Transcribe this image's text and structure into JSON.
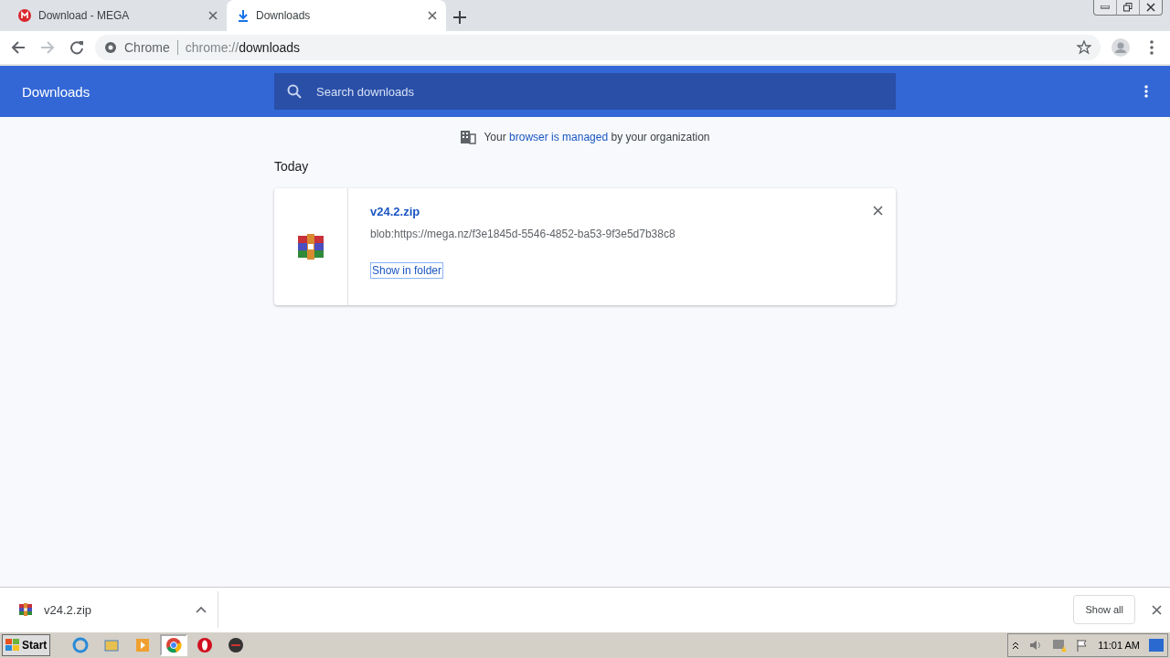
{
  "tabs": [
    {
      "title": "Download - MEGA",
      "kind": "mega",
      "selected": false
    },
    {
      "title": "Downloads",
      "kind": "download",
      "selected": true
    }
  ],
  "address": {
    "site_label": "Chrome",
    "scheme": "chrome://",
    "path": "downloads"
  },
  "header": {
    "title": "Downloads",
    "search_placeholder": "Search downloads"
  },
  "notice": {
    "before": "Your",
    "link": "browser is managed",
    "after": "by your organization"
  },
  "section": "Today",
  "downloads": [
    {
      "name": "v24.2.zip",
      "url": "blob:https://mega.nz/f3e1845d-5546-4852-ba53-9f3e5d7b38c8",
      "action": "Show in folder"
    }
  ],
  "shelf": {
    "items": [
      {
        "name": "v24.2.zip"
      }
    ],
    "show_all": "Show all"
  },
  "taskbar": {
    "start": "Start",
    "apps": [
      {
        "kind": "ie",
        "selected": false
      },
      {
        "kind": "explorer",
        "selected": false
      },
      {
        "kind": "media",
        "selected": false
      },
      {
        "kind": "chrome",
        "selected": true
      },
      {
        "kind": "opera",
        "selected": false
      },
      {
        "kind": "other",
        "selected": false
      }
    ],
    "clock": "11:01 AM"
  }
}
